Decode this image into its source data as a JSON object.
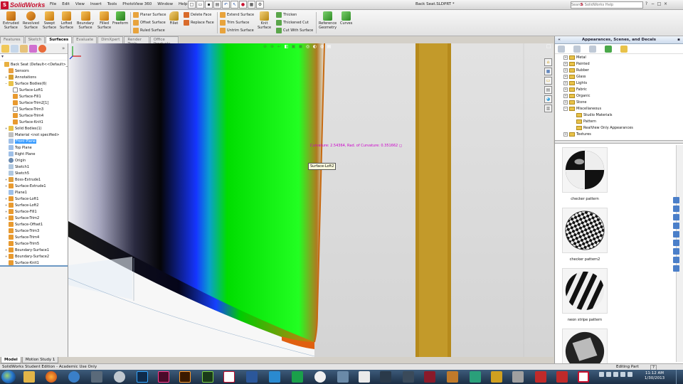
{
  "window": {
    "brand": "SolidWorks",
    "document_title": "Back Seat.SLDPRT *",
    "menus": [
      "File",
      "Edit",
      "View",
      "Insert",
      "Tools",
      "PhotoView 360",
      "Window",
      "Help"
    ],
    "help_placeholder": "Search SolidWorks Help",
    "controls": [
      "?",
      "−",
      "□",
      "×"
    ]
  },
  "commands": {
    "big": [
      {
        "label1": "Extruded",
        "label2": "Surface"
      },
      {
        "label1": "Revolved",
        "label2": "Surface"
      },
      {
        "label1": "Swept",
        "label2": "Surface"
      },
      {
        "label1": "Lofted",
        "label2": "Surface"
      },
      {
        "label1": "Boundary",
        "label2": "Surface"
      },
      {
        "label1": "Filled",
        "label2": "Surface"
      },
      {
        "label1": "Freeform",
        "label2": ""
      },
      {
        "label1": "Fillet",
        "label2": ""
      },
      {
        "label1": "Knit",
        "label2": "Surface"
      },
      {
        "label1": "Reference",
        "label2": "Geometry"
      },
      {
        "label1": "Curves",
        "label2": ""
      }
    ],
    "small": [
      "Planar Surface",
      "Offset Surface",
      "Ruled Surface",
      "Delete Face",
      "Replace Face",
      "Extend Surface",
      "Trim Surface",
      "Untrim Surface",
      "Thicken",
      "Thickened Cut",
      "Cut With Surface"
    ]
  },
  "tabs": [
    {
      "label": "Features",
      "active": false
    },
    {
      "label": "Sketch",
      "active": false
    },
    {
      "label": "Surfaces",
      "active": true
    },
    {
      "label": "Evaluate",
      "active": false
    },
    {
      "label": "DimXpert",
      "active": false
    },
    {
      "label": "Render Tools",
      "active": false
    },
    {
      "label": "Office Products",
      "active": false
    }
  ],
  "tree": [
    {
      "label": "Back Seat  (Default<<Default>_",
      "level": 0,
      "exp": "",
      "icon": "part",
      "sel": false
    },
    {
      "label": "Sensors",
      "level": 1,
      "exp": "",
      "icon": "sensor",
      "sel": false
    },
    {
      "label": "Annotations",
      "level": 1,
      "exp": "+",
      "icon": "annot",
      "sel": false
    },
    {
      "label": "Surface Bodies(6)",
      "level": 1,
      "exp": "−",
      "icon": "folder",
      "sel": false
    },
    {
      "label": "Surface-Loft1",
      "level": 2,
      "exp": "",
      "icon": "hollow",
      "sel": false
    },
    {
      "label": "Surface-Fill1",
      "level": 2,
      "exp": "",
      "icon": "surface",
      "sel": false
    },
    {
      "label": "Surface-Trim2[1]",
      "level": 2,
      "exp": "",
      "icon": "surface",
      "sel": false
    },
    {
      "label": "Surface-Trim3",
      "level": 2,
      "exp": "",
      "icon": "hollow",
      "sel": false
    },
    {
      "label": "Surface-Trim4",
      "level": 2,
      "exp": "",
      "icon": "surface",
      "sel": false
    },
    {
      "label": "Surface-Knit1",
      "level": 2,
      "exp": "",
      "icon": "surface",
      "sel": false
    },
    {
      "label": "Solid Bodies(1)",
      "level": 1,
      "exp": "+",
      "icon": "folder",
      "sel": false
    },
    {
      "label": "Material <not specified>",
      "level": 1,
      "exp": "",
      "icon": "material",
      "sel": false
    },
    {
      "label": "Front Plane",
      "level": 1,
      "exp": "",
      "icon": "plane",
      "sel": true
    },
    {
      "label": "Top Plane",
      "level": 1,
      "exp": "",
      "icon": "plane",
      "sel": false
    },
    {
      "label": "Right Plane",
      "level": 1,
      "exp": "",
      "icon": "plane",
      "sel": false
    },
    {
      "label": "Origin",
      "level": 1,
      "exp": "",
      "icon": "origin",
      "sel": false
    },
    {
      "label": "Sketch1",
      "level": 1,
      "exp": "",
      "icon": "sketch",
      "sel": false
    },
    {
      "label": "Sketch5",
      "level": 1,
      "exp": "",
      "icon": "sketch",
      "sel": false
    },
    {
      "label": "Boss-Extrude1",
      "level": 1,
      "exp": "+",
      "icon": "feature",
      "sel": false
    },
    {
      "label": "Surface-Extrude1",
      "level": 1,
      "exp": "+",
      "icon": "surface",
      "sel": false
    },
    {
      "label": "Plane1",
      "level": 1,
      "exp": "",
      "icon": "plane",
      "sel": false
    },
    {
      "label": "Surface-Loft1",
      "level": 1,
      "exp": "+",
      "icon": "surface",
      "sel": false
    },
    {
      "label": "Surface-Loft2",
      "level": 1,
      "exp": "+",
      "icon": "surface",
      "sel": false
    },
    {
      "label": "Surface-Fill1",
      "level": 1,
      "exp": "+",
      "icon": "surface",
      "sel": false
    },
    {
      "label": "Surface-Trim2",
      "level": 1,
      "exp": "+",
      "icon": "surface",
      "sel": false
    },
    {
      "label": "Surface-Offset1",
      "level": 1,
      "exp": "",
      "icon": "surface",
      "sel": false
    },
    {
      "label": "Surface-Trim3",
      "level": 1,
      "exp": "",
      "icon": "surface",
      "sel": false
    },
    {
      "label": "Surface-Trim4",
      "level": 1,
      "exp": "",
      "icon": "surface",
      "sel": false
    },
    {
      "label": "Surface-Trim5",
      "level": 1,
      "exp": "",
      "icon": "surface",
      "sel": false
    },
    {
      "label": "Boundary-Surface1",
      "level": 1,
      "exp": "+",
      "icon": "surface",
      "sel": false
    },
    {
      "label": "Boundary-Surface2",
      "level": 1,
      "exp": "+",
      "icon": "surface",
      "sel": false
    },
    {
      "label": "Surface-Knit1",
      "level": 1,
      "exp": "",
      "icon": "surface",
      "sel": false
    }
  ],
  "viewport": {
    "curvature_text": "Curvature: 2.54364, Rad. of Curvature: 0.351662 ◻",
    "curvature_prefix": "Curvature:",
    "tooltip": "Surface-Loft2",
    "colors": {
      "green": "#00dd00",
      "blue": "#1540ff",
      "tan": "#b08a1a",
      "orange": "#d07a10"
    }
  },
  "appearances": {
    "title": "Appearances, Scenes, and Decals",
    "tree": [
      {
        "label": "Metal",
        "level": 1,
        "pm": "+"
      },
      {
        "label": "Painted",
        "level": 1,
        "pm": "+"
      },
      {
        "label": "Rubber",
        "level": 1,
        "pm": "+"
      },
      {
        "label": "Glass",
        "level": 1,
        "pm": "+"
      },
      {
        "label": "Lights",
        "level": 1,
        "pm": "+"
      },
      {
        "label": "Fabric",
        "level": 1,
        "pm": "+"
      },
      {
        "label": "Organic",
        "level": 1,
        "pm": "+"
      },
      {
        "label": "Stone",
        "level": 1,
        "pm": "+"
      },
      {
        "label": "Miscellaneous",
        "level": 1,
        "pm": "−"
      },
      {
        "label": "Studio Materials",
        "level": 2,
        "pm": ""
      },
      {
        "label": "Pattern",
        "level": 2,
        "pm": ""
      },
      {
        "label": "RealView Only Appearances",
        "level": 2,
        "pm": ""
      },
      {
        "label": "Textures",
        "level": 1,
        "pm": "+"
      }
    ],
    "swatches": [
      {
        "label": "checker pattern"
      },
      {
        "label": "checker pattern2"
      },
      {
        "label": "neon stripe pattern"
      },
      {
        "label": ""
      }
    ]
  },
  "model_tabs": [
    {
      "label": "Model",
      "active": true
    },
    {
      "label": "Motion Study 1",
      "active": false
    }
  ],
  "status": {
    "left": "SolidWorks Student Edition - Academic Use Only",
    "mode": "Editing Part",
    "help": "?"
  },
  "taskbar": {
    "time": "11:12 AM",
    "date": "1/30/2013"
  }
}
